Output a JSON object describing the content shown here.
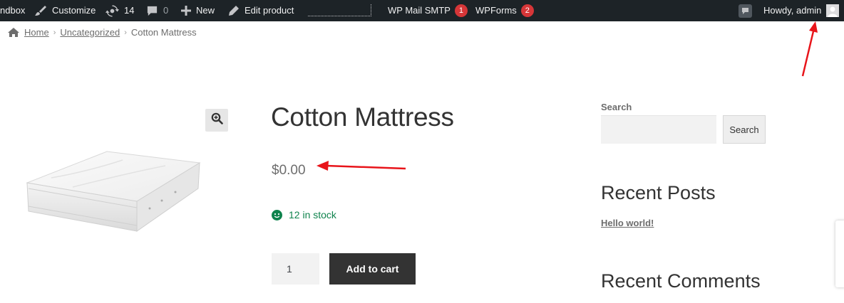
{
  "admin_bar": {
    "sandbox_label": "ndbox",
    "customize_label": "Customize",
    "updates_count": "14",
    "comments_count": "0",
    "new_label": "New",
    "edit_label": "Edit product",
    "wp_mail_label": "WP Mail SMTP",
    "wp_mail_badge": "1",
    "wpforms_label": "WPForms",
    "wpforms_badge": "2",
    "howdy_label": "Howdy, admin"
  },
  "breadcrumb": {
    "home": "Home",
    "category": "Uncategorized",
    "current": "Cotton Mattress"
  },
  "product": {
    "title": "Cotton Mattress",
    "price": "$0.00",
    "stock": "12 in stock",
    "quantity": "1",
    "add_to_cart": "Add to cart"
  },
  "sidebar": {
    "search_label": "Search",
    "search_button": "Search",
    "recent_posts_title": "Recent Posts",
    "recent_post_1": "Hello world!",
    "recent_comments_title": "Recent Comments"
  },
  "colors": {
    "admin_bar_bg": "#1d2327",
    "badge": "#d63638",
    "stock_green": "#0f834d",
    "button_dark": "#333333",
    "annotation_red": "#e8141a"
  }
}
